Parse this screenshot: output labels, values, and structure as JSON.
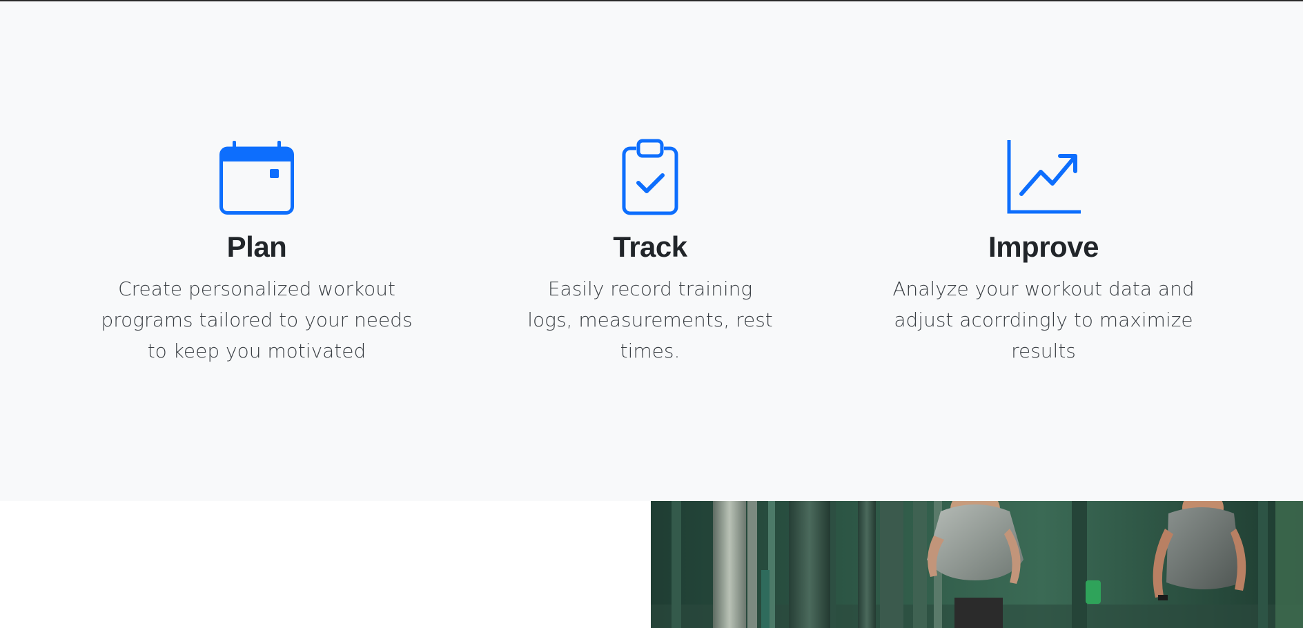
{
  "colors": {
    "accent": "#0d6efd",
    "section_background": "#f8f9fa",
    "heading": "#212529",
    "body_text": "#3a3f44"
  },
  "features": [
    {
      "icon": "calendar-icon",
      "title": "Plan",
      "description": "Create personalized workout programs tailored to your needs to keep you motivated"
    },
    {
      "icon": "clipboard-check-icon",
      "title": "Track",
      "description": "Easily record training logs, measurements, rest times."
    },
    {
      "icon": "graph-up-arrow-icon",
      "title": "Improve",
      "description": "Analyze your workout data and adjust acorrdingly to maximize results"
    }
  ],
  "hero_image": {
    "subject": "runners-in-park-image"
  }
}
